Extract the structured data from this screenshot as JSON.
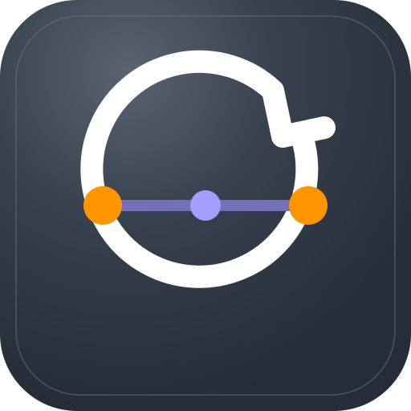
{
  "app_icon": {
    "glyph": "rotate-arc-with-diameter-icon",
    "colors": {
      "tile_highlight": "#5a6470",
      "tile_dark": "#262d39",
      "tile_border": "#6b7480",
      "arc": "#ffffff",
      "endpoint": "#ff9500",
      "midpoint": "#a49cff",
      "diameter_line": "#7570b8"
    }
  }
}
